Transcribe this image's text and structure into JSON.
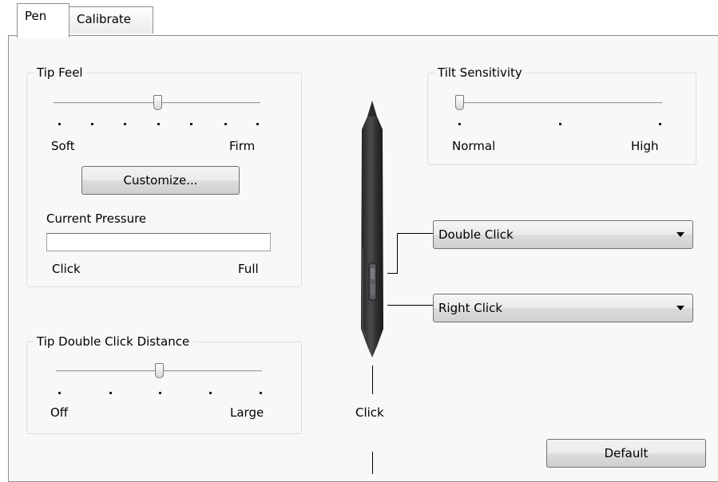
{
  "tabs": [
    {
      "label": "Pen",
      "active": true
    },
    {
      "label": "Calibrate",
      "active": false
    }
  ],
  "tip_feel": {
    "title": "Tip Feel",
    "min_label": "Soft",
    "max_label": "Firm",
    "slider_position": "4 of 7",
    "customize_label": "Customize...",
    "current_pressure_label": "Current Pressure",
    "pressure_level": 0,
    "pressure_min_label": "Click",
    "pressure_max_label": "Full"
  },
  "tip_double_click": {
    "title": "Tip Double Click Distance",
    "min_label": "Off",
    "max_label": "Large",
    "slider_position": "3 of 5"
  },
  "tilt": {
    "title": "Tilt Sensitivity",
    "min_label": "Normal",
    "max_label": "High",
    "slider_position": "1 of 3"
  },
  "pen": {
    "upper_button_value": "Double Click",
    "lower_button_value": "Right Click",
    "tip_label": "Click"
  },
  "default_label": "Default",
  "colors": {
    "panel_bg": "#f8f8f8",
    "group_border": "#d5dfe5",
    "pen_body": "#3a3b3d"
  },
  "icons": [
    "pen-illustration",
    "dropdown-arrow-icon"
  ]
}
